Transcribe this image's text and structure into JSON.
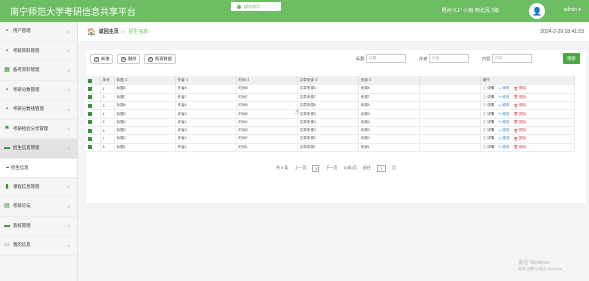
{
  "app": {
    "title": "南宁师范大学考研信息共享平台"
  },
  "toast": {
    "text": "操作成功"
  },
  "header": {
    "weather": "梧州 9.1° 小雨 西北风 2级",
    "user": "admin",
    "user_caret": "▾",
    "avatar_glyph": "👤"
  },
  "sidebar": {
    "items": [
      {
        "label": "用户管理",
        "icon": "users-icon"
      },
      {
        "label": "考研资料管理",
        "icon": "grid-icon"
      },
      {
        "label": "备考资料管理",
        "icon": "table-icon"
      },
      {
        "label": "考研分数管理",
        "icon": "grid-icon"
      },
      {
        "label": "考研分数线管理",
        "icon": "grid-icon"
      },
      {
        "label": "考研经验分享管理",
        "icon": "flag-icon"
      },
      {
        "label": "招生信息管理",
        "icon": "list-icon",
        "active": true
      },
      {
        "label": "课程信息管理",
        "icon": "chart-icon"
      },
      {
        "label": "考研论坛",
        "icon": "doc-icon"
      },
      {
        "label": "系统管理",
        "icon": "monitor-icon"
      },
      {
        "label": "我的信息",
        "icon": "form-icon"
      }
    ],
    "subitem": {
      "label": "招生信息"
    },
    "arrow": "∨"
  },
  "breadcrumb": {
    "home": "返回主页",
    "sep": "▷",
    "current": "招生信息"
  },
  "datetime": "2024-2-29 18:41:53",
  "toolbar": {
    "add_label": "新增",
    "delete_label": "删除",
    "report_label": "报表数据",
    "filters": [
      {
        "label": "标题",
        "placeholder": "标题"
      },
      {
        "label": "作者",
        "placeholder": "作者"
      },
      {
        "label": "内容",
        "placeholder": "内容"
      }
    ],
    "search_label": "搜索"
  },
  "table": {
    "headers": [
      "序号",
      "标题",
      "作者",
      "时间",
      "文章来源",
      "来源",
      "操作"
    ],
    "sort_mark": "⇕",
    "rows": [
      [
        "1",
        "标题8",
        "作者8",
        "时间8",
        "文章来源8",
        "来源8"
      ],
      [
        "2",
        "标题7",
        "作者7",
        "时间7",
        "文章来源7",
        "来源7"
      ],
      [
        "3",
        "标题6",
        "作者6",
        "时间6",
        "文章来源6",
        "来源6"
      ],
      [
        "4",
        "标题5",
        "作者5",
        "时间5",
        "文章来源5",
        "来源5"
      ],
      [
        "5",
        "标题4",
        "作者4",
        "时间4",
        "文章来源4",
        "来源4"
      ],
      [
        "6",
        "标题3",
        "作者3",
        "时间3",
        "文章来源3",
        "来源3"
      ],
      [
        "7",
        "标题2",
        "作者2",
        "时间2",
        "文章来源2",
        "来源2"
      ],
      [
        "8",
        "标题1",
        "作者1",
        "时间1",
        "文章来源1",
        "来源1"
      ]
    ],
    "actions": {
      "view": "详情",
      "edit": "修改",
      "delete": "删除"
    }
  },
  "pager": {
    "total": "共 8 条",
    "prev": "上一页",
    "page": "1",
    "next": "下一页",
    "per_page": "10条/页",
    "goto": "前往",
    "goto_value": "1",
    "goto_unit": "页"
  },
  "watermark": {
    "line1": "激活 Windows",
    "line2": "转到\"设置\"以激活 Windows。"
  },
  "colors": {
    "brand_green": "#6dbd63",
    "button_green": "#4aa843",
    "edit_blue": "#2f7fd0",
    "delete_red": "#e34a4a"
  }
}
